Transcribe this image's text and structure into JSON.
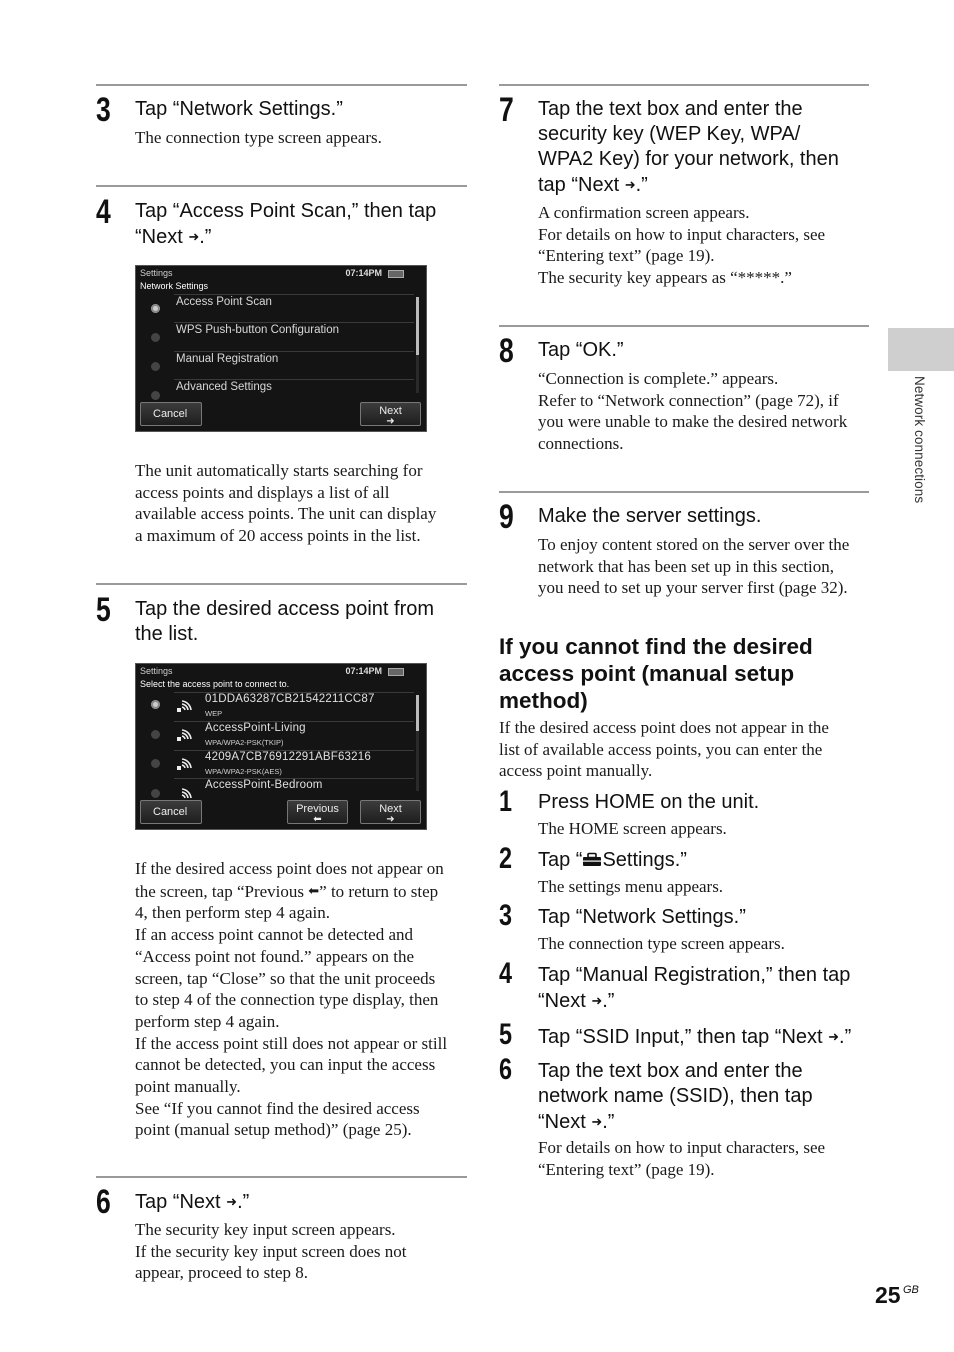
{
  "page": {
    "number": "25",
    "suffix": "GB",
    "side_tab_label": "Network connections"
  },
  "left_column": {
    "step3": {
      "number": "3",
      "heading": "Tap “Network Settings.”",
      "body": "The connection type screen appears."
    },
    "step4": {
      "number": "4",
      "heading_line1": "Tap “Access Point Scan,” then tap",
      "heading_line2_pre": "“Next ",
      "heading_line2_post": ".”",
      "body_lines": [
        "The unit automatically starts searching for",
        "access points and displays a list of all",
        "available access points. The unit can display",
        "a maximum of 20 access points in the list."
      ]
    },
    "screen1": {
      "header": "Settings",
      "subheader": "Network Settings",
      "time": "07:14PM",
      "items": [
        {
          "label": "Access Point Scan",
          "selected": true
        },
        {
          "label": "WPS Push-button Configuration",
          "selected": false
        },
        {
          "label": "Manual Registration",
          "selected": false
        },
        {
          "label": "Advanced Settings",
          "selected": false
        }
      ],
      "buttons": {
        "cancel": "Cancel",
        "next": "Next"
      }
    },
    "step5": {
      "number": "5",
      "heading_line1": "Tap the desired access point from",
      "heading_line2": "the list.",
      "body_lines": [
        "If the desired access point does not appear on",
        "the screen, tap “Previous |ARROW_LEFT|” to return to step",
        "4, then perform step 4 again.",
        "If an access point cannot be detected and",
        "“Access point not found.” appears on the",
        "screen, tap “Close” so that the unit proceeds",
        "to step 4 of the connection type display, then",
        "perform step 4 again.",
        "If the access point still does not appear or still",
        "cannot be detected, you can input the access",
        "point manually.",
        "See “If you cannot find the desired access",
        "point (manual setup method)” (page 25)."
      ],
      "previous_line_pre": "the screen, tap “Previous ",
      "previous_line_post": "” to return to step"
    },
    "screen2": {
      "header": "Settings",
      "subheader": "Select the access point to connect to.",
      "time": "07:14PM",
      "access_points": [
        {
          "ssid": "01DDA63287CB21542211CC87",
          "security": "WEP",
          "selected": true
        },
        {
          "ssid": "AccessPoint-Living",
          "security": "WPA/WPA2-PSK(TKIP)",
          "selected": false
        },
        {
          "ssid": "4209A7CB76912291ABF63216",
          "security": "WPA/WPA2-PSK(AES)",
          "selected": false
        },
        {
          "ssid": "AccessPoint-Bedroom",
          "security": "",
          "selected": false
        }
      ],
      "buttons": {
        "cancel": "Cancel",
        "previous": "Previous",
        "next": "Next"
      }
    },
    "step6": {
      "number": "6",
      "heading_pre": "Tap “Next ",
      "heading_post": ".”",
      "body_lines": [
        "The security key input screen appears.",
        "If the security key input screen does not",
        "appear, proceed to step 8."
      ]
    }
  },
  "right_column": {
    "step7": {
      "number": "7",
      "heading_lines": [
        "Tap the text box and enter the",
        "security key (WEP Key, WPA/",
        "WPA2 Key) for your network, then"
      ],
      "heading_last_pre": "tap “Next ",
      "heading_last_post": ".”",
      "body_lines": [
        "A confirmation screen appears.",
        "For details on how to input characters, see",
        "“Entering text” (page 19).",
        "The security key appears as “*****.”"
      ]
    },
    "step8": {
      "number": "8",
      "heading": "Tap “OK.”",
      "body_lines": [
        "“Connection is complete.” appears.",
        "Refer to “Network connection” (page 72), if",
        "you were unable to make the desired network",
        "connections."
      ]
    },
    "step9": {
      "number": "9",
      "heading": "Make the server settings.",
      "body_lines": [
        "To enjoy content stored on the server over the",
        "network that has been set up in this section,",
        "you need to set up your server first (page 32)."
      ]
    },
    "manual_section": {
      "title_lines": [
        "If you cannot find the desired",
        "access point (manual setup",
        "method)"
      ],
      "intro_lines": [
        "If the desired access point does not appear in the",
        "list of available access points, you can enter the",
        "access point manually."
      ],
      "steps": [
        {
          "number": "1",
          "heading": "Press HOME on the unit.",
          "body": "The HOME screen appears."
        },
        {
          "number": "2",
          "heading_pre": "Tap “",
          "heading_post": "Settings.”",
          "body": "The settings menu appears."
        },
        {
          "number": "3",
          "heading": "Tap “Network Settings.”",
          "body": "The connection type screen appears."
        },
        {
          "number": "4",
          "heading_line1": "Tap “Manual Registration,” then tap",
          "heading_line2_pre": "“Next ",
          "heading_line2_post": ".”"
        },
        {
          "number": "5",
          "heading_pre": "Tap “SSID Input,” then tap “Next ",
          "heading_post": ".”"
        },
        {
          "number": "6",
          "heading_lines": [
            "Tap the text box and enter the",
            "network name (SSID), then tap"
          ],
          "heading_last_pre": "“Next ",
          "heading_last_post": ".”",
          "body_lines": [
            "For details on how to input characters, see",
            "“Entering text” (page 19)."
          ]
        }
      ]
    }
  },
  "icons": {
    "arrow_right": "➜",
    "arrow_left": "⬅"
  }
}
